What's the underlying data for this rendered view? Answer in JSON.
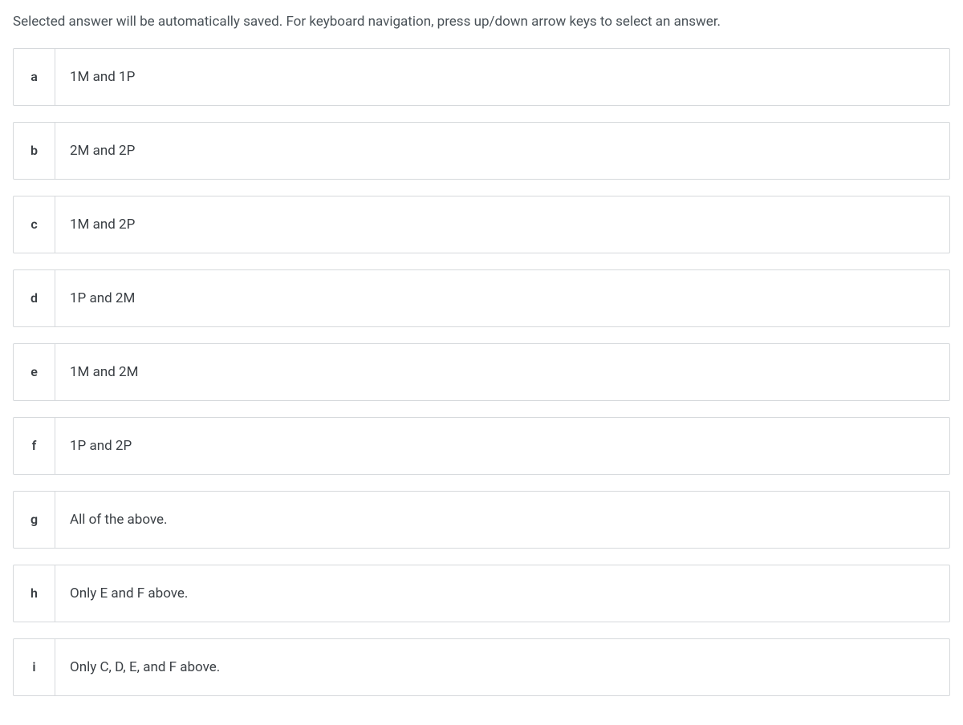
{
  "instruction": "Selected answer will be automatically saved. For keyboard navigation, press up/down arrow keys to select an answer.",
  "options": [
    {
      "letter": "a",
      "text": "1M and 1P"
    },
    {
      "letter": "b",
      "text": "2M and 2P"
    },
    {
      "letter": "c",
      "text": "1M and 2P"
    },
    {
      "letter": "d",
      "text": "1P and 2M"
    },
    {
      "letter": "e",
      "text": "1M and 2M"
    },
    {
      "letter": "f",
      "text": "1P and 2P"
    },
    {
      "letter": "g",
      "text": "All of the above."
    },
    {
      "letter": "h",
      "text": "Only E and F above."
    },
    {
      "letter": "i",
      "text": "Only C, D, E, and F above."
    }
  ]
}
